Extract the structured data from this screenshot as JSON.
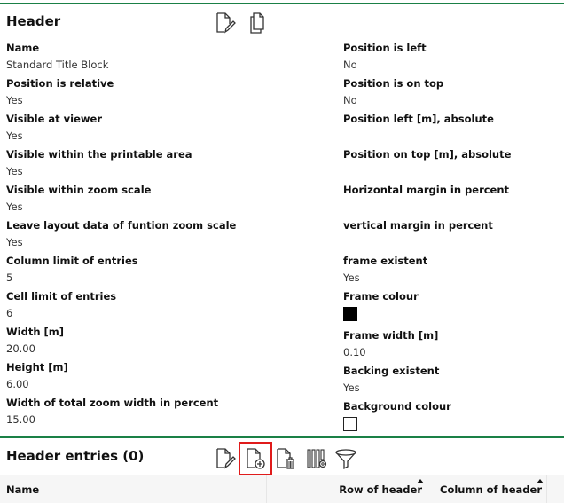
{
  "header_section": {
    "title": "Header",
    "toolbar": [
      {
        "icon": "document-edit-icon",
        "label": "Edit"
      },
      {
        "icon": "document-copy-icon",
        "label": "Copy"
      }
    ],
    "left_fields": [
      {
        "label": "Name",
        "value": "Standard Title Block"
      },
      {
        "label": "Position is relative",
        "value": "Yes"
      },
      {
        "label": "Visible at viewer",
        "value": "Yes"
      },
      {
        "label": "Visible within the printable area",
        "value": "Yes"
      },
      {
        "label": "Visible within zoom scale",
        "value": "Yes"
      },
      {
        "label": "Leave layout data of funtion zoom scale",
        "value": "Yes"
      },
      {
        "label": "Column limit of entries",
        "value": "5"
      },
      {
        "label": "Cell limit of entries",
        "value": "6"
      },
      {
        "label": "Width [m]",
        "value": "20.00"
      },
      {
        "label": "Height [m]",
        "value": "6.00"
      },
      {
        "label": "Width of total zoom width in percent",
        "value": "15.00"
      }
    ],
    "right_fields": [
      {
        "label": "Position is left",
        "value": "No"
      },
      {
        "label": "Position is on top",
        "value": "No"
      },
      {
        "label": "Position left [m], absolute",
        "value": ""
      },
      {
        "label": "Position on top [m], absolute",
        "value": ""
      },
      {
        "label": "Horizontal margin in percent",
        "value": ""
      },
      {
        "label": "vertical margin in percent",
        "value": ""
      },
      {
        "label": "frame existent",
        "value": "Yes"
      },
      {
        "label": "Frame colour",
        "color": "#000000"
      },
      {
        "label": "Frame width [m]",
        "value": "0.10"
      },
      {
        "label": "Backing existent",
        "value": "Yes"
      },
      {
        "label": "Background colour",
        "color": "#ffffff"
      }
    ]
  },
  "entries_section": {
    "title": "Header entries (0)",
    "toolbar": [
      {
        "icon": "document-edit-icon",
        "label": "Edit"
      },
      {
        "icon": "document-add-icon",
        "label": "Add",
        "highlighted": true
      },
      {
        "icon": "document-delete-icon",
        "label": "Delete"
      },
      {
        "icon": "columns-settings-icon",
        "label": "Column settings"
      },
      {
        "icon": "filter-icon",
        "label": "Filter"
      }
    ],
    "columns": [
      {
        "label": "Name"
      },
      {
        "label": "Row of header",
        "sorted": "ascending"
      },
      {
        "label": "Column of header",
        "sorted": "ascending"
      }
    ]
  },
  "colors": {
    "accent_line": "#1a8046",
    "highlight": "#e01b1b"
  }
}
